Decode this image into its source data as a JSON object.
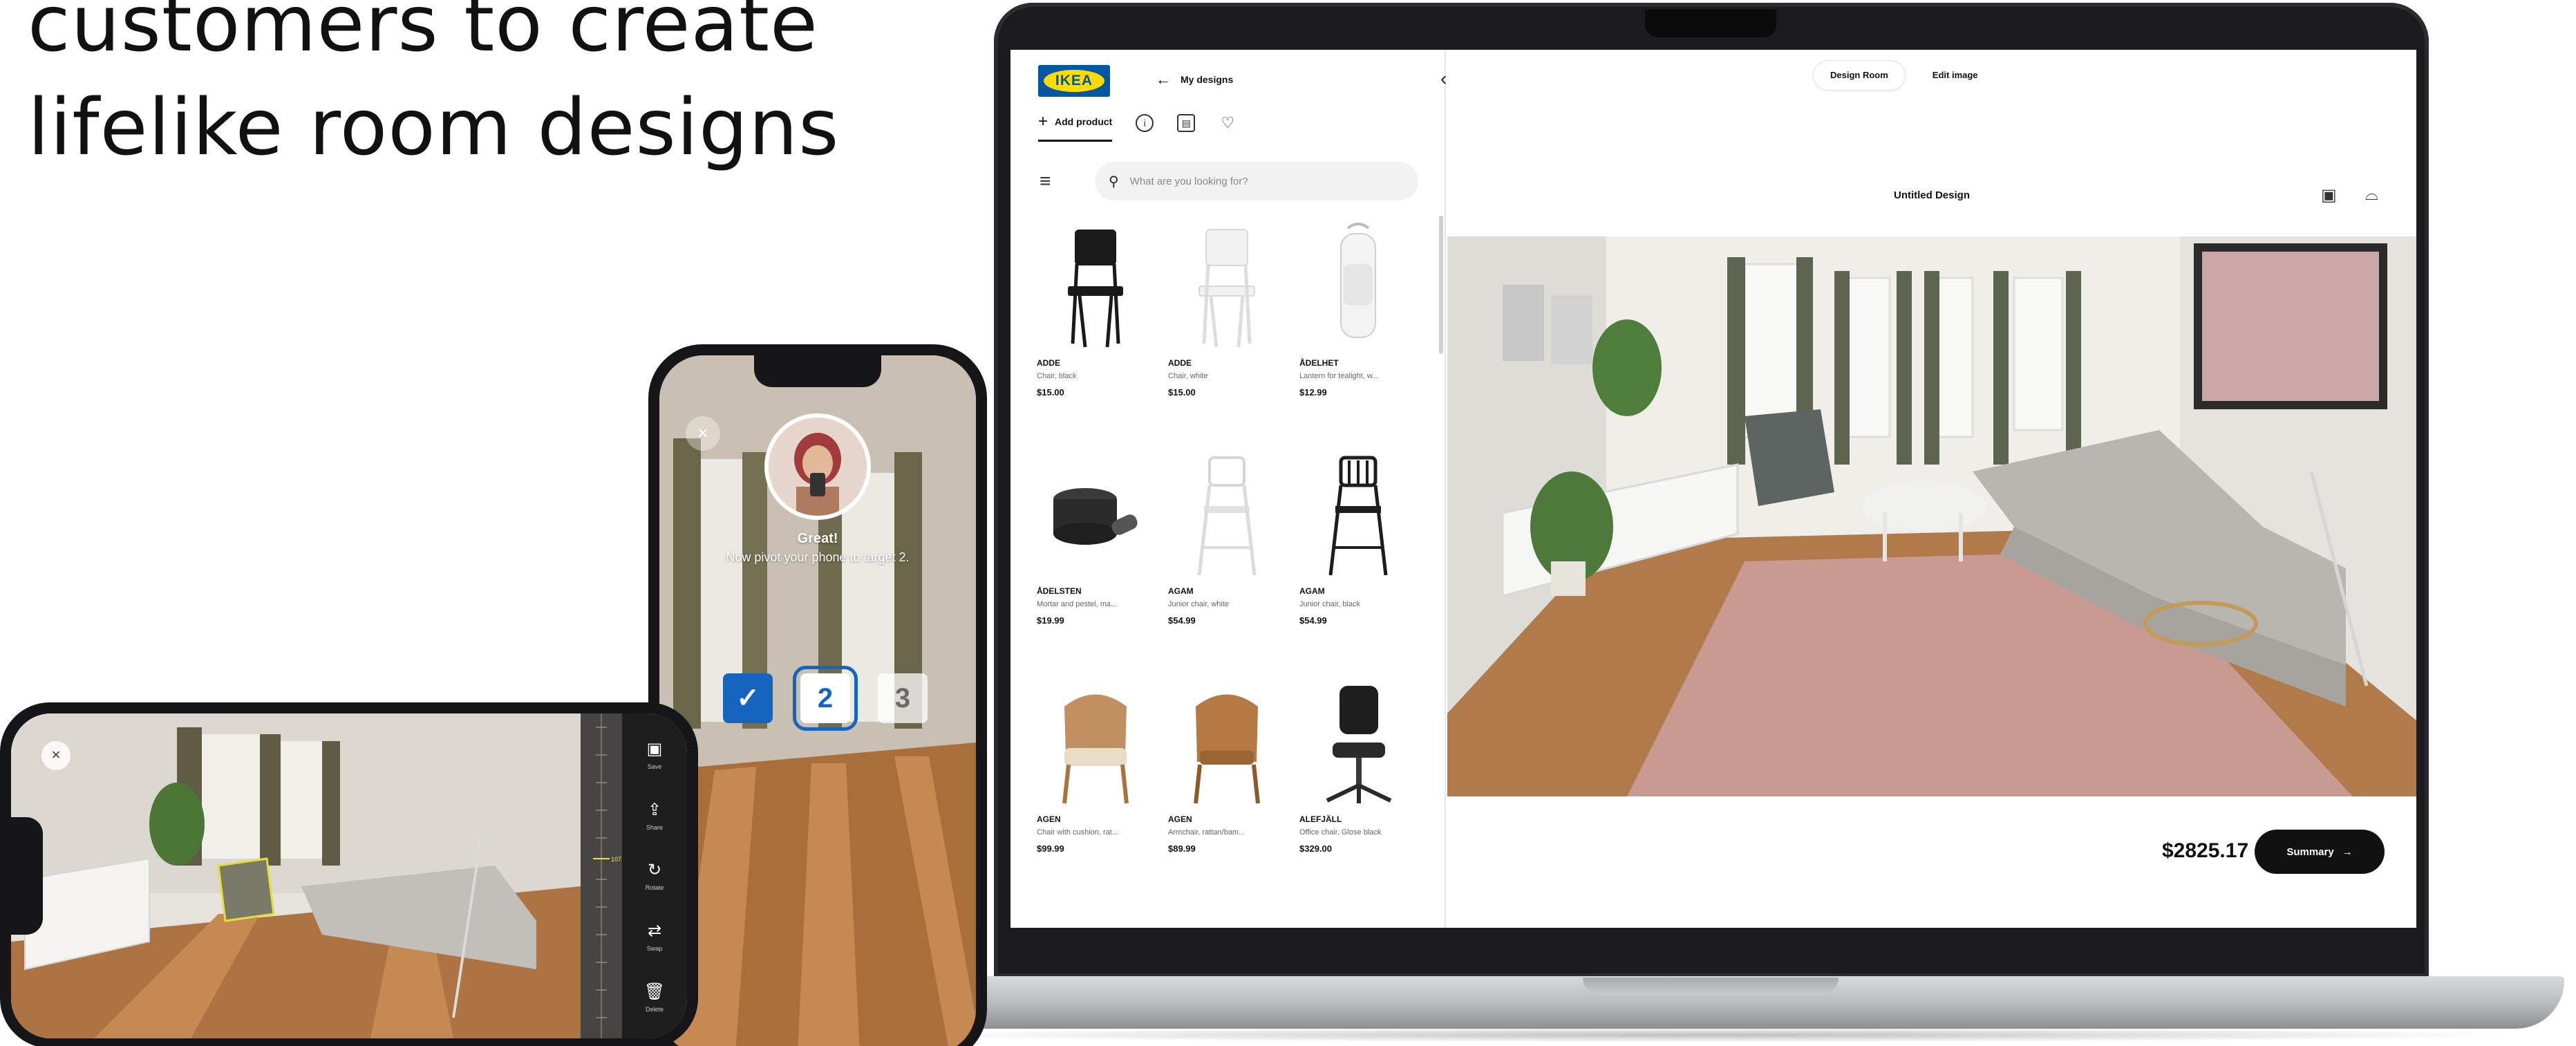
{
  "headline": {
    "line1": "customers to create",
    "line2": "lifelike room designs"
  },
  "app": {
    "logo_text": "IKEA",
    "back_label": "My designs",
    "add_product_label": "Add product",
    "search_placeholder": "What are you looking for?",
    "view_tabs": [
      "Design Room",
      "Edit image"
    ],
    "design_title": "Untitled Design",
    "total_price": "$2825.17",
    "summary_label": "Summary",
    "icons": {
      "back": "arrow-left-icon",
      "collapse": "chevron-left-icon",
      "plus": "plus-icon",
      "info": "info-icon",
      "layout": "layout-icon",
      "favorite": "heart-icon",
      "menu": "hamburger-icon",
      "search": "magnifier-icon",
      "save": "save-icon",
      "cart": "shopping-bag-icon",
      "summary_arrow": "arrow-right-icon"
    },
    "products": [
      {
        "name": "ADDE",
        "desc": "Chair, black",
        "price": "$15.00",
        "kind": "black-chair"
      },
      {
        "name": "ADDE",
        "desc": "Chair, white",
        "price": "$15.00",
        "kind": "white-chair"
      },
      {
        "name": "ÅDELHET",
        "desc": "Lantern for tealight, w...",
        "price": "$12.99",
        "kind": "lantern"
      },
      {
        "name": "ÅDELSTEN",
        "desc": "Mortar and pestel, ma...",
        "price": "$19.99",
        "kind": "mortar"
      },
      {
        "name": "AGAM",
        "desc": "Junior chair, white",
        "price": "$54.99",
        "kind": "white-highchair"
      },
      {
        "name": "AGAM",
        "desc": "Junior chair, black",
        "price": "$54.99",
        "kind": "black-highchair"
      },
      {
        "name": "AGEN",
        "desc": "Chair with cushion, rat...",
        "price": "$99.99",
        "kind": "rattan-chair"
      },
      {
        "name": "AGEN",
        "desc": "Armchair, rattan/bam...",
        "price": "$89.99",
        "kind": "rattan-armchair"
      },
      {
        "name": "ALEFJÄLL",
        "desc": "Office chair, Glose black",
        "price": "$329.00",
        "kind": "office-chair"
      }
    ]
  },
  "phone_portrait": {
    "message_title": "Great!",
    "message_body": "Now pivot your phone to target 2.",
    "targets": [
      "✓",
      "2",
      "3"
    ],
    "close_symbol": "×"
  },
  "phone_landscape": {
    "close_symbol": "×",
    "tools": [
      {
        "icon": "save-icon",
        "label": "Save"
      },
      {
        "icon": "share-icon",
        "label": "Share"
      },
      {
        "icon": "rotate-icon",
        "label": "Rotate"
      },
      {
        "icon": "swap-icon",
        "label": "Swap"
      },
      {
        "icon": "trash-icon",
        "label": "Delete"
      }
    ],
    "ruler_label": "107"
  }
}
